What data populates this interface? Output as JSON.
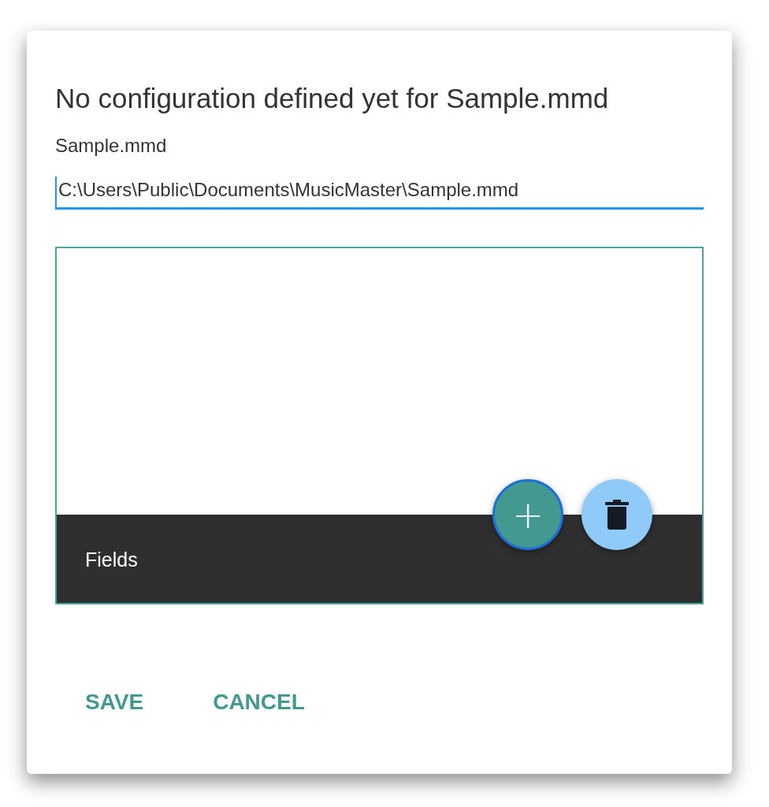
{
  "dialog": {
    "title": "No configuration defined yet for Sample.mmd",
    "file_label": "Sample.mmd",
    "path_field": {
      "value": "C:\\Users\\Public\\Documents\\MusicMaster\\Sample.mmd",
      "focused": true
    }
  },
  "fields_panel": {
    "label": "Fields",
    "buttons": [
      {
        "kind": "add",
        "label": "+",
        "focused": true
      },
      {
        "kind": "delete",
        "focused": false
      }
    ]
  },
  "buttons": [
    {
      "label": "SAVE"
    },
    {
      "label": "CANCEL"
    }
  ]
}
